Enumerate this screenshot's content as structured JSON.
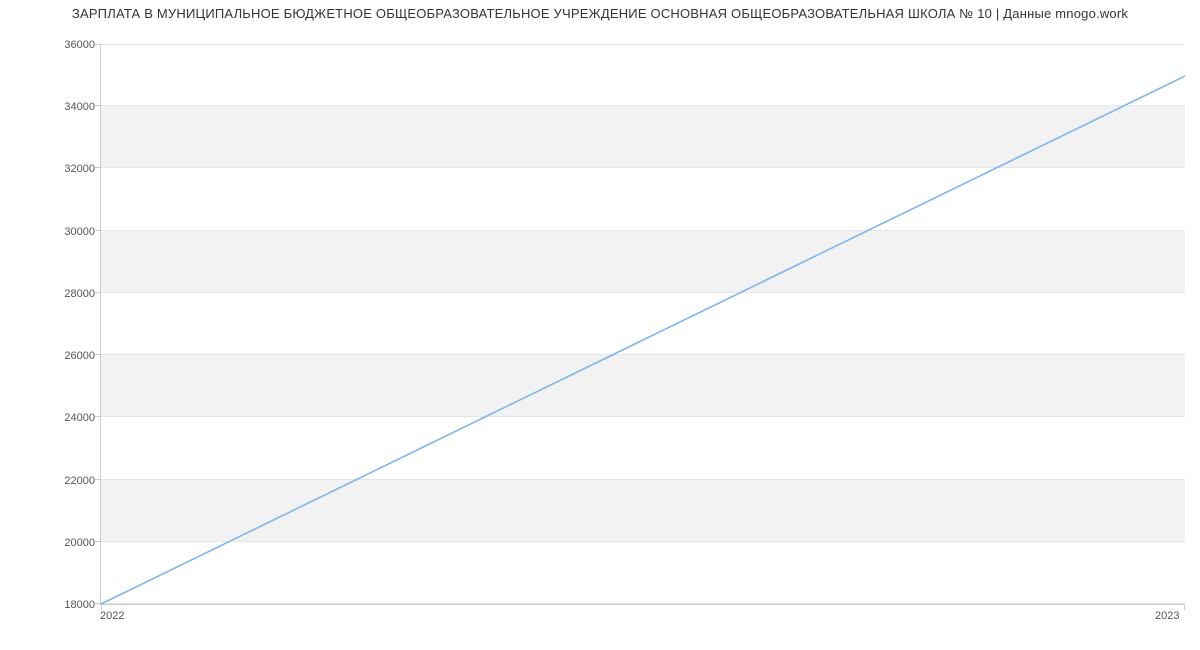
{
  "chart_data": {
    "type": "line",
    "title": "ЗАРПЛАТА В МУНИЦИПАЛЬНОЕ БЮДЖЕТНОЕ ОБЩЕОБРАЗОВАТЕЛЬНОЕ УЧРЕЖДЕНИЕ ОСНОВНАЯ ОБЩЕОБРАЗОВАТЕЛЬНАЯ ШКОЛА № 10 | Данные mnogo.work",
    "x": [
      "2022",
      "2023"
    ],
    "values": [
      18000,
      35000
    ],
    "xlabel": "",
    "ylabel": "",
    "xlim": [
      "2022",
      "2023"
    ],
    "ylim": [
      18000,
      36000
    ],
    "yticks": [
      18000,
      20000,
      22000,
      24000,
      26000,
      28000,
      30000,
      32000,
      34000,
      36000
    ],
    "xticks": [
      "2022",
      "2023"
    ],
    "line_color": "#7cb5ec",
    "band_color": "#f2f2f2"
  }
}
